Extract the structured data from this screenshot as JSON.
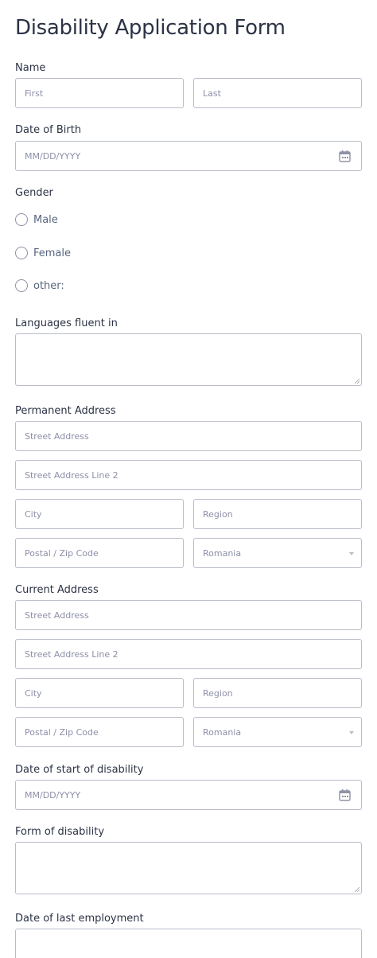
{
  "form": {
    "title": "Disability Application Form",
    "name": {
      "label": "Name",
      "first_placeholder": "First",
      "last_placeholder": "Last"
    },
    "dob": {
      "label": "Date of Birth",
      "placeholder": "MM/DD/YYYY"
    },
    "gender": {
      "label": "Gender",
      "options": [
        "Male",
        "Female",
        "other:"
      ]
    },
    "languages": {
      "label": "Languages fluent in"
    },
    "permanent_address": {
      "label": "Permanent Address",
      "street": "Street Address",
      "street2": "Street Address Line 2",
      "city": "City",
      "region": "Region",
      "postal": "Postal / Zip Code",
      "country": "Romania"
    },
    "current_address": {
      "label": "Current Address",
      "street": "Street Address",
      "street2": "Street Address Line 2",
      "city": "City",
      "region": "Region",
      "postal": "Postal / Zip Code",
      "country": "Romania"
    },
    "disability_start": {
      "label": "Date of start of disability",
      "placeholder": "MM/DD/YYYY"
    },
    "disability_form": {
      "label": "Form of disability"
    },
    "last_employment": {
      "label": "Date of last employment"
    }
  },
  "colors": {
    "border": "#b8bdc9",
    "text": "#2c3345",
    "placeholder": "#8d8fa8"
  },
  "icons": {
    "calendar": "calendar-icon",
    "dropdown": "chevron-down-icon",
    "resize": "resize-grip-icon"
  }
}
